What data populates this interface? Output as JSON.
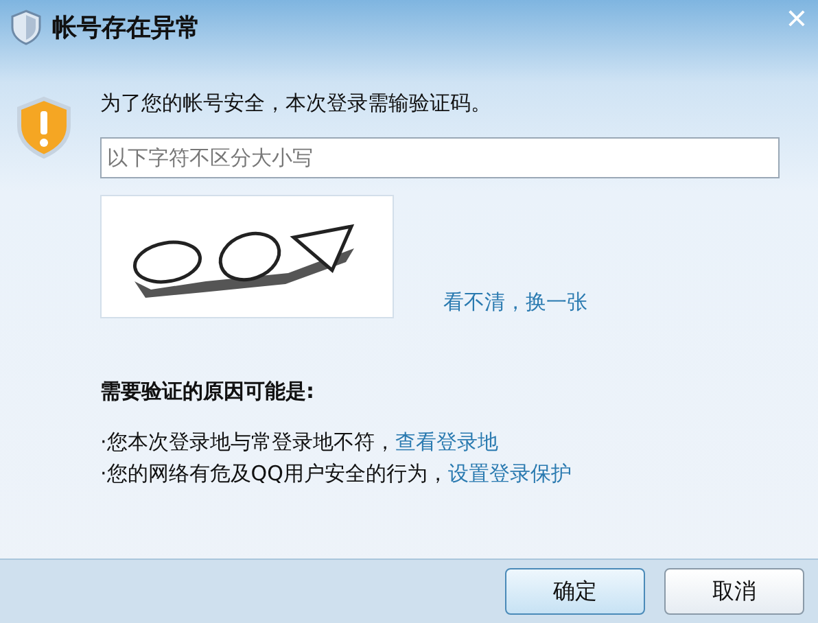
{
  "window": {
    "title": "帐号存在异常",
    "close": "×"
  },
  "message": "为了您的帐号安全，本次登录需输验证码。",
  "captcha_input": {
    "placeholder": "以下字符不区分大小写"
  },
  "refresh_link": "看不清，换一张",
  "reasons_heading": "需要验证的原因可能是:",
  "reasons": [
    {
      "text": "·您本次登录地与常登录地不符，",
      "link": "查看登录地"
    },
    {
      "text": "·您的网络有危及QQ用户安全的行为，",
      "link": "设置登录保护"
    }
  ],
  "buttons": [
    {
      "label": "确定",
      "default": true
    },
    {
      "label": "取消",
      "default": false
    }
  ]
}
